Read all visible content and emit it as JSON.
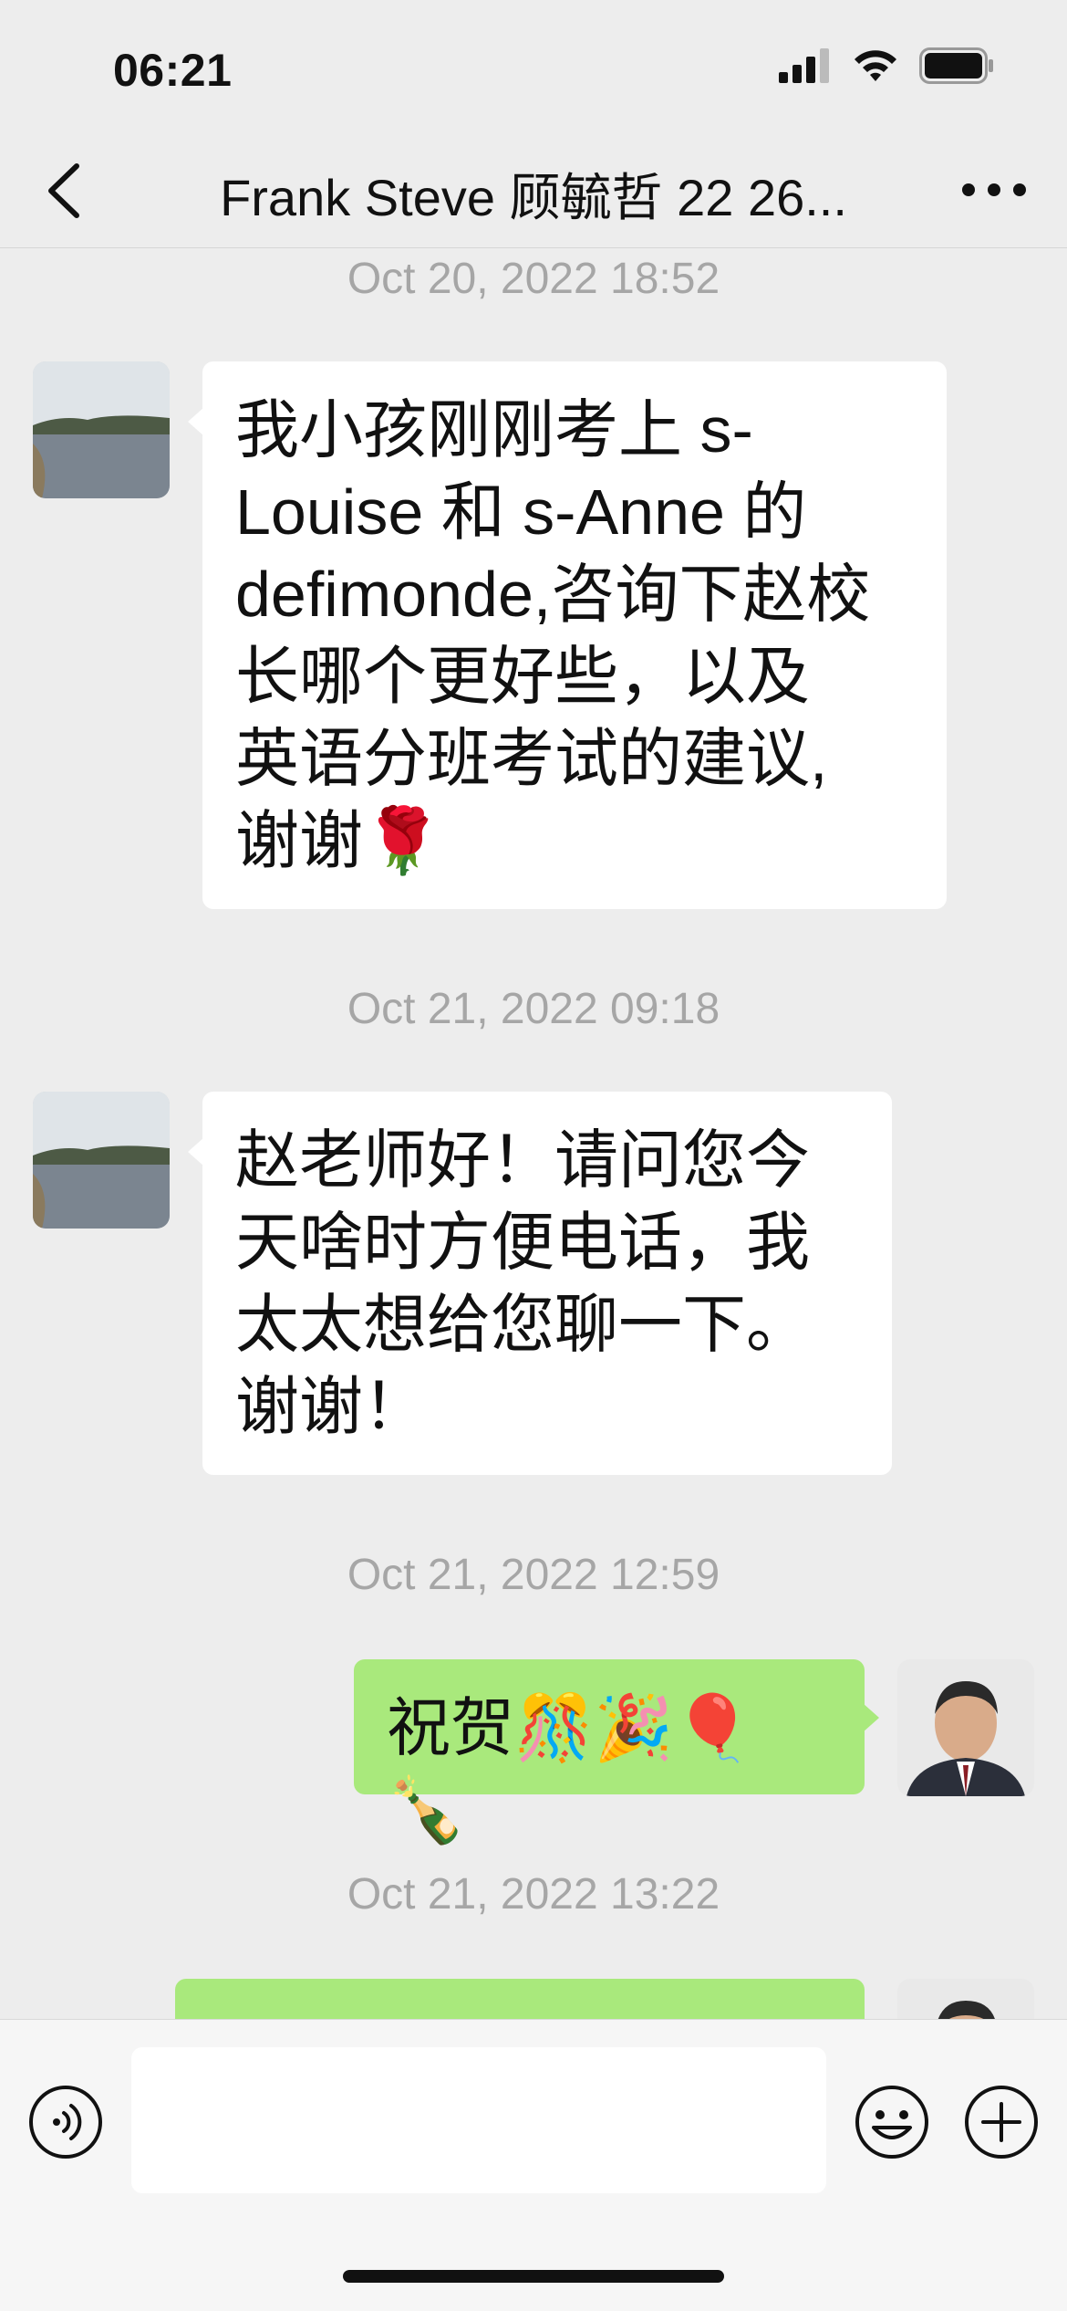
{
  "status_bar": {
    "time": "06:21",
    "icons": [
      "signal-icon",
      "wifi-icon",
      "battery-icon"
    ]
  },
  "nav": {
    "title": "Frank Steve 顾毓哲 22 26...",
    "back_icon": "chevron-left-icon",
    "more_icon": "ellipsis-icon"
  },
  "messages": [
    {
      "timestamp": "Oct 20, 2022 18:52",
      "direction": "incoming",
      "lines": [
        "我小孩刚刚考上 s-",
        "Louise 和 s-Anne 的",
        "defimonde,咨询下赵校",
        "长哪个更好些，以及",
        "英语分班考试的建议,",
        "谢谢🌹"
      ]
    },
    {
      "timestamp": "Oct 21, 2022 09:18",
      "direction": "incoming",
      "lines": [
        "赵老师好！请问您今",
        "天啥时方便电话，我",
        "太太想给您聊一下。",
        "谢谢！"
      ]
    },
    {
      "timestamp": "Oct 21, 2022 12:59",
      "direction": "outgoing",
      "lines": [
        "祝贺🎊🎉🎈🍾"
      ]
    },
    {
      "timestamp": "Oct 21, 2022 13:22",
      "direction": "outgoing",
      "lines": [
        ""
      ]
    }
  ],
  "input": {
    "placeholder": "",
    "voice_icon": "voice-icon",
    "emoji_icon": "emoji-icon",
    "plus_icon": "plus-icon"
  },
  "colors": {
    "background": "#ededed",
    "incoming_bubble": "#ffffff",
    "outgoing_bubble": "#a9e97c",
    "timestamp": "#a6a6a6"
  }
}
